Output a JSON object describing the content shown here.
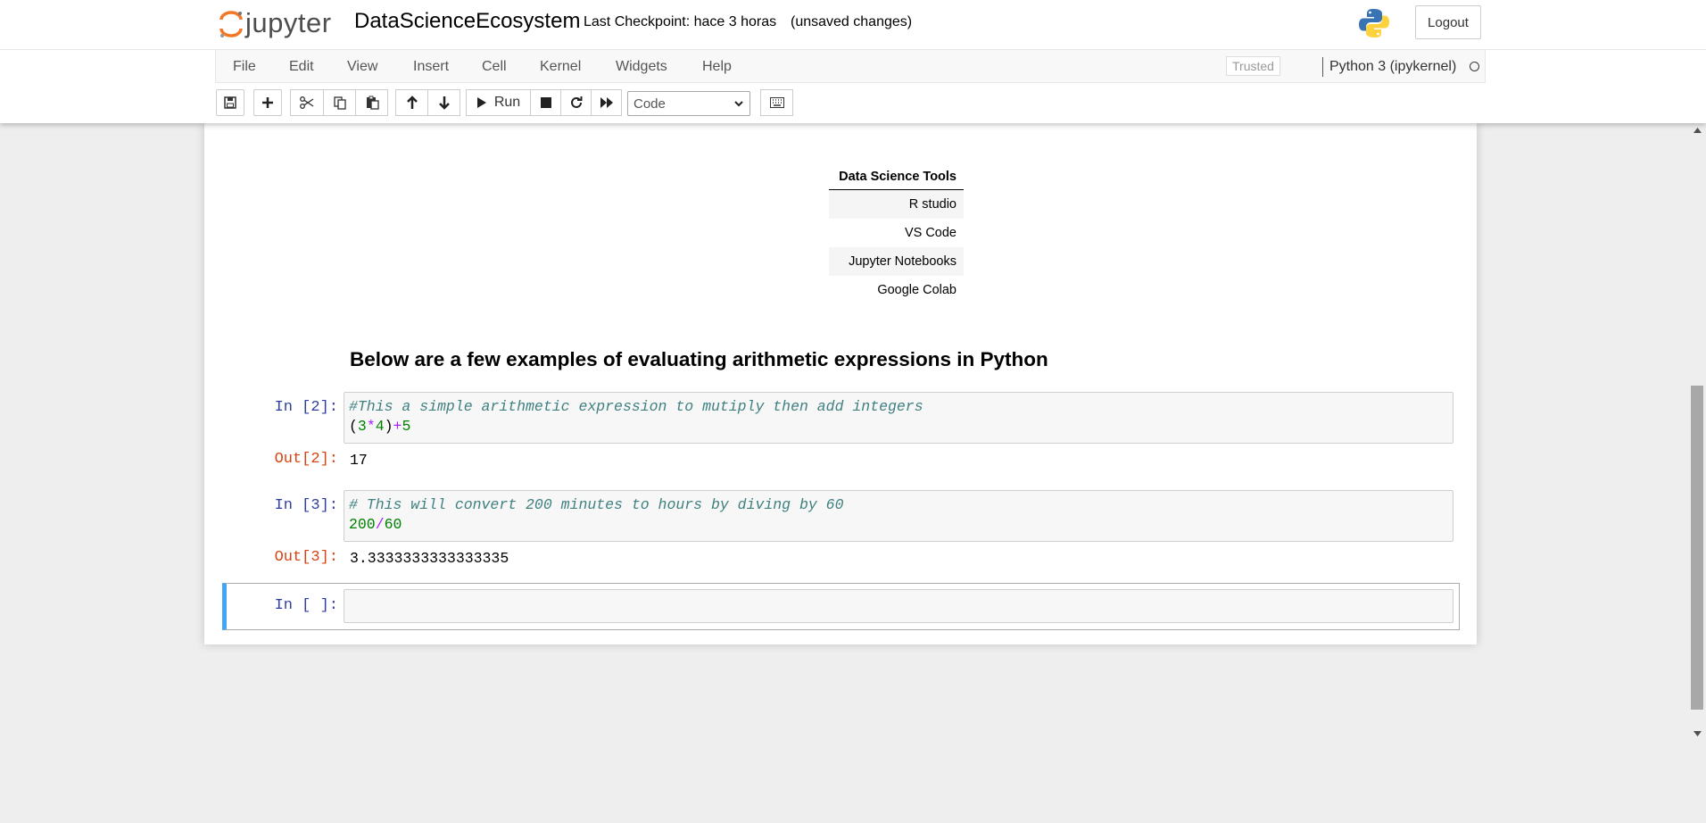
{
  "header": {
    "logo_text": "jupyter",
    "notebook_title": "DataScienceEcosystem",
    "checkpoint": "Last Checkpoint: hace 3 horas",
    "unsaved": "(unsaved changes)",
    "logout_label": "Logout"
  },
  "menu": {
    "items": [
      "File",
      "Edit",
      "View",
      "Insert",
      "Cell",
      "Kernel",
      "Widgets",
      "Help"
    ],
    "trusted": "Trusted",
    "kernel": "Python 3 (ipykernel)"
  },
  "toolbar": {
    "run_label": "Run",
    "cell_type": "Code"
  },
  "notebook": {
    "table": {
      "header": "Data Science Tools",
      "rows": [
        "R studio",
        "VS Code",
        "Jupyter Notebooks",
        "Google Colab"
      ]
    },
    "heading": "Below are a few examples of evaluating arithmetic expressions in Python",
    "cells": [
      {
        "in_prompt": "In [2]:",
        "comment": "#This a simple arithmetic expression to mutiply then add integers",
        "out_prompt": "Out[2]:",
        "output": "17"
      },
      {
        "in_prompt": "In [3]:",
        "comment": "# This will convert 200 minutes to hours by diving by 60",
        "out_prompt": "Out[3]:",
        "output": "3.3333333333333335"
      }
    ],
    "empty_prompt": "In [ ]:"
  }
}
